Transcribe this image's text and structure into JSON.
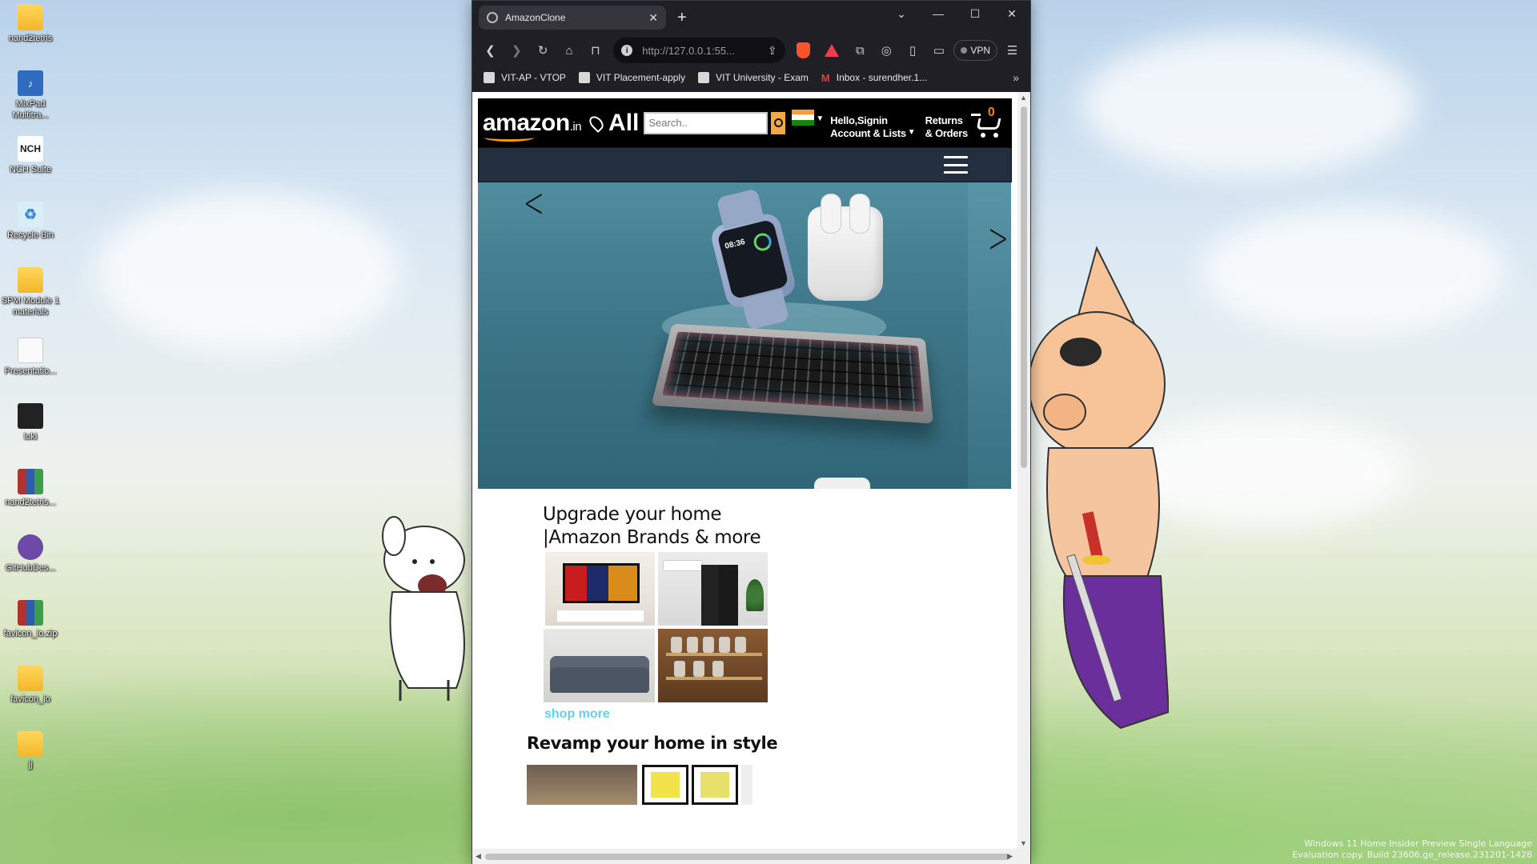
{
  "desktop": {
    "icons": [
      {
        "label": "nand2tetris",
        "icon": "folder-icon"
      },
      {
        "label": "MixPad Multitra...",
        "icon": "mixpad-icon"
      },
      {
        "label": "NCH Suite",
        "icon": "nch-icon"
      },
      {
        "label": "Recycle Bin",
        "icon": "recycle-bin-icon"
      },
      {
        "label": "SPM Module 1 materials",
        "icon": "folder-icon"
      },
      {
        "label": "Presentatio...",
        "icon": "document-icon"
      },
      {
        "label": "loki",
        "icon": "folder-icon"
      },
      {
        "label": "nand2tetris...",
        "icon": "winrar-icon"
      },
      {
        "label": "GitHubDes...",
        "icon": "github-icon"
      },
      {
        "label": "favicon_io.zip",
        "icon": "winrar-icon"
      },
      {
        "label": "favicon_io",
        "icon": "folder-icon"
      },
      {
        "label": "jj",
        "icon": "folder-icon"
      }
    ],
    "watermark_line1": "Windows 11 Home Insider Preview Single Language",
    "watermark_line2": "Evaluation copy. Build 23606.ge_release.231201-1428"
  },
  "browser": {
    "tab_title": "AmazonClone",
    "new_tab": "+",
    "url": "http://127.0.0.1:55...",
    "vpn_label": "VPN",
    "bookmarks": [
      {
        "label": "VIT-AP - VTOP"
      },
      {
        "label": "VIT Placement-apply"
      },
      {
        "label": "VIT University - Exam"
      },
      {
        "label": "Inbox - surendher.1..."
      }
    ],
    "bookmarks_more": "»"
  },
  "page": {
    "logo": "amazon",
    "logo_tld": ".in",
    "all_label": "All",
    "search_placeholder": "Search..",
    "account_line1": "Hello,Signin",
    "account_line2": "Account & Lists",
    "returns_line1": "Returns",
    "returns_line2": "& Orders",
    "cart_count": "0",
    "watch_time": "08:36",
    "section1_title": "Upgrade your home |Amazon Brands & more",
    "shop_more": "shop more",
    "section2_title": "Revamp your home in style"
  },
  "colors": {
    "amazon_orange": "#ff9900",
    "header_bg": "#000000",
    "nav_bg": "#232f3e",
    "shop_more": "#5fd3e6"
  }
}
